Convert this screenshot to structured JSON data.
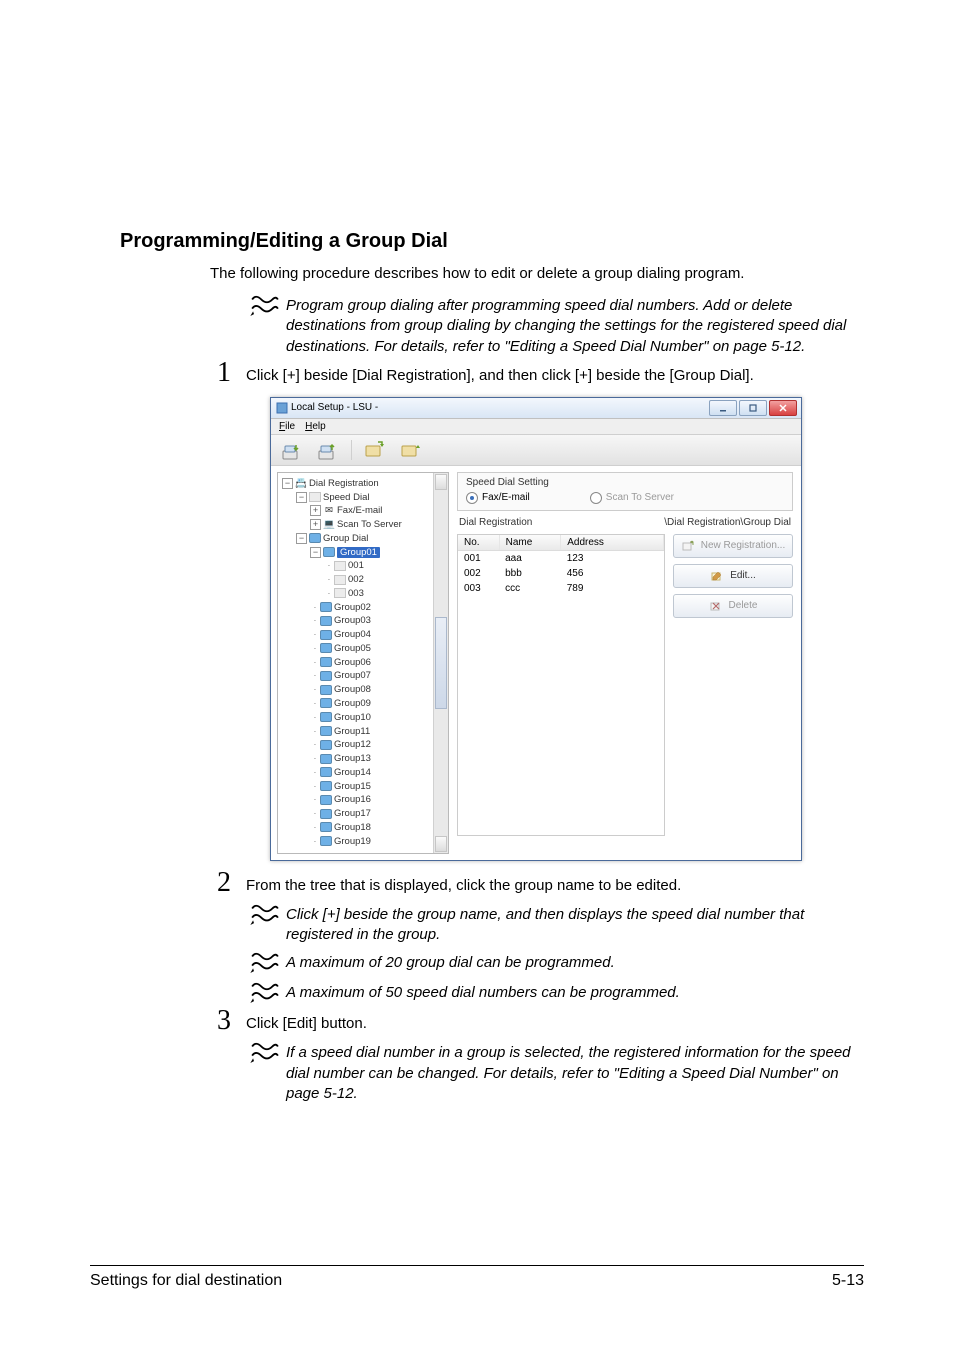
{
  "section_title": "Programming/Editing a Group Dial",
  "intro": "The following procedure describes how to edit or delete a group dialing program.",
  "note1": "Program group dialing after programming speed dial numbers. Add or delete destinations from group dialing by changing the settings for the registered speed dial destinations. For details, refer to \"Editing a Speed Dial Number\" on page 5-12.",
  "steps": {
    "s1_num": "1",
    "s1_text": "Click [+] beside [Dial Registration], and then click [+] beside the [Group Dial].",
    "s2_num": "2",
    "s2_text": "From the tree that is displayed, click the group name to be edited.",
    "s3_num": "3",
    "s3_text": "Click [Edit] button."
  },
  "note2": "Click [+] beside the group name, and then displays the speed dial number that registered in the group.",
  "note3": "A maximum of 20 group dial can be programmed.",
  "note4": "A maximum of 50 speed dial numbers can be programmed.",
  "note5": "If a speed dial number in a group is selected, the registered information for the speed dial number can be changed. For details, refer to \"Editing a Speed Dial Number\" on page 5-12.",
  "footer": {
    "left": "Settings for dial destination",
    "right": "5-13"
  },
  "window": {
    "title": "Local Setup - LSU -",
    "menu": {
      "file": "File",
      "help": "Help"
    },
    "right": {
      "header_title": "Speed Dial Setting",
      "radio_fax": "Fax/E-mail",
      "radio_scan": "Scan To Server",
      "left_label": "Dial Registration",
      "right_label": "\\Dial Registration\\Group Dial",
      "cols": {
        "no": "No.",
        "name": "Name",
        "address": "Address"
      },
      "rows": [
        {
          "no": "001",
          "name": "aaa",
          "address": "123"
        },
        {
          "no": "002",
          "name": "bbb",
          "address": "456"
        },
        {
          "no": "003",
          "name": "ccc",
          "address": "789"
        }
      ],
      "btn_new": "New Registration...",
      "btn_edit": "Edit...",
      "btn_delete": "Delete"
    },
    "tree": {
      "root": "Dial Registration",
      "speed": "Speed Dial",
      "fax": "Fax/E-mail",
      "scan": "Scan To Server",
      "group": "Group Dial",
      "sel": "Group01",
      "leaf_001": "001",
      "leaf_002": "002",
      "leaf_003": "003",
      "groups": [
        "Group02",
        "Group03",
        "Group04",
        "Group05",
        "Group06",
        "Group07",
        "Group08",
        "Group09",
        "Group10",
        "Group11",
        "Group12",
        "Group13",
        "Group14",
        "Group15",
        "Group16",
        "Group17",
        "Group18",
        "Group19"
      ]
    }
  }
}
